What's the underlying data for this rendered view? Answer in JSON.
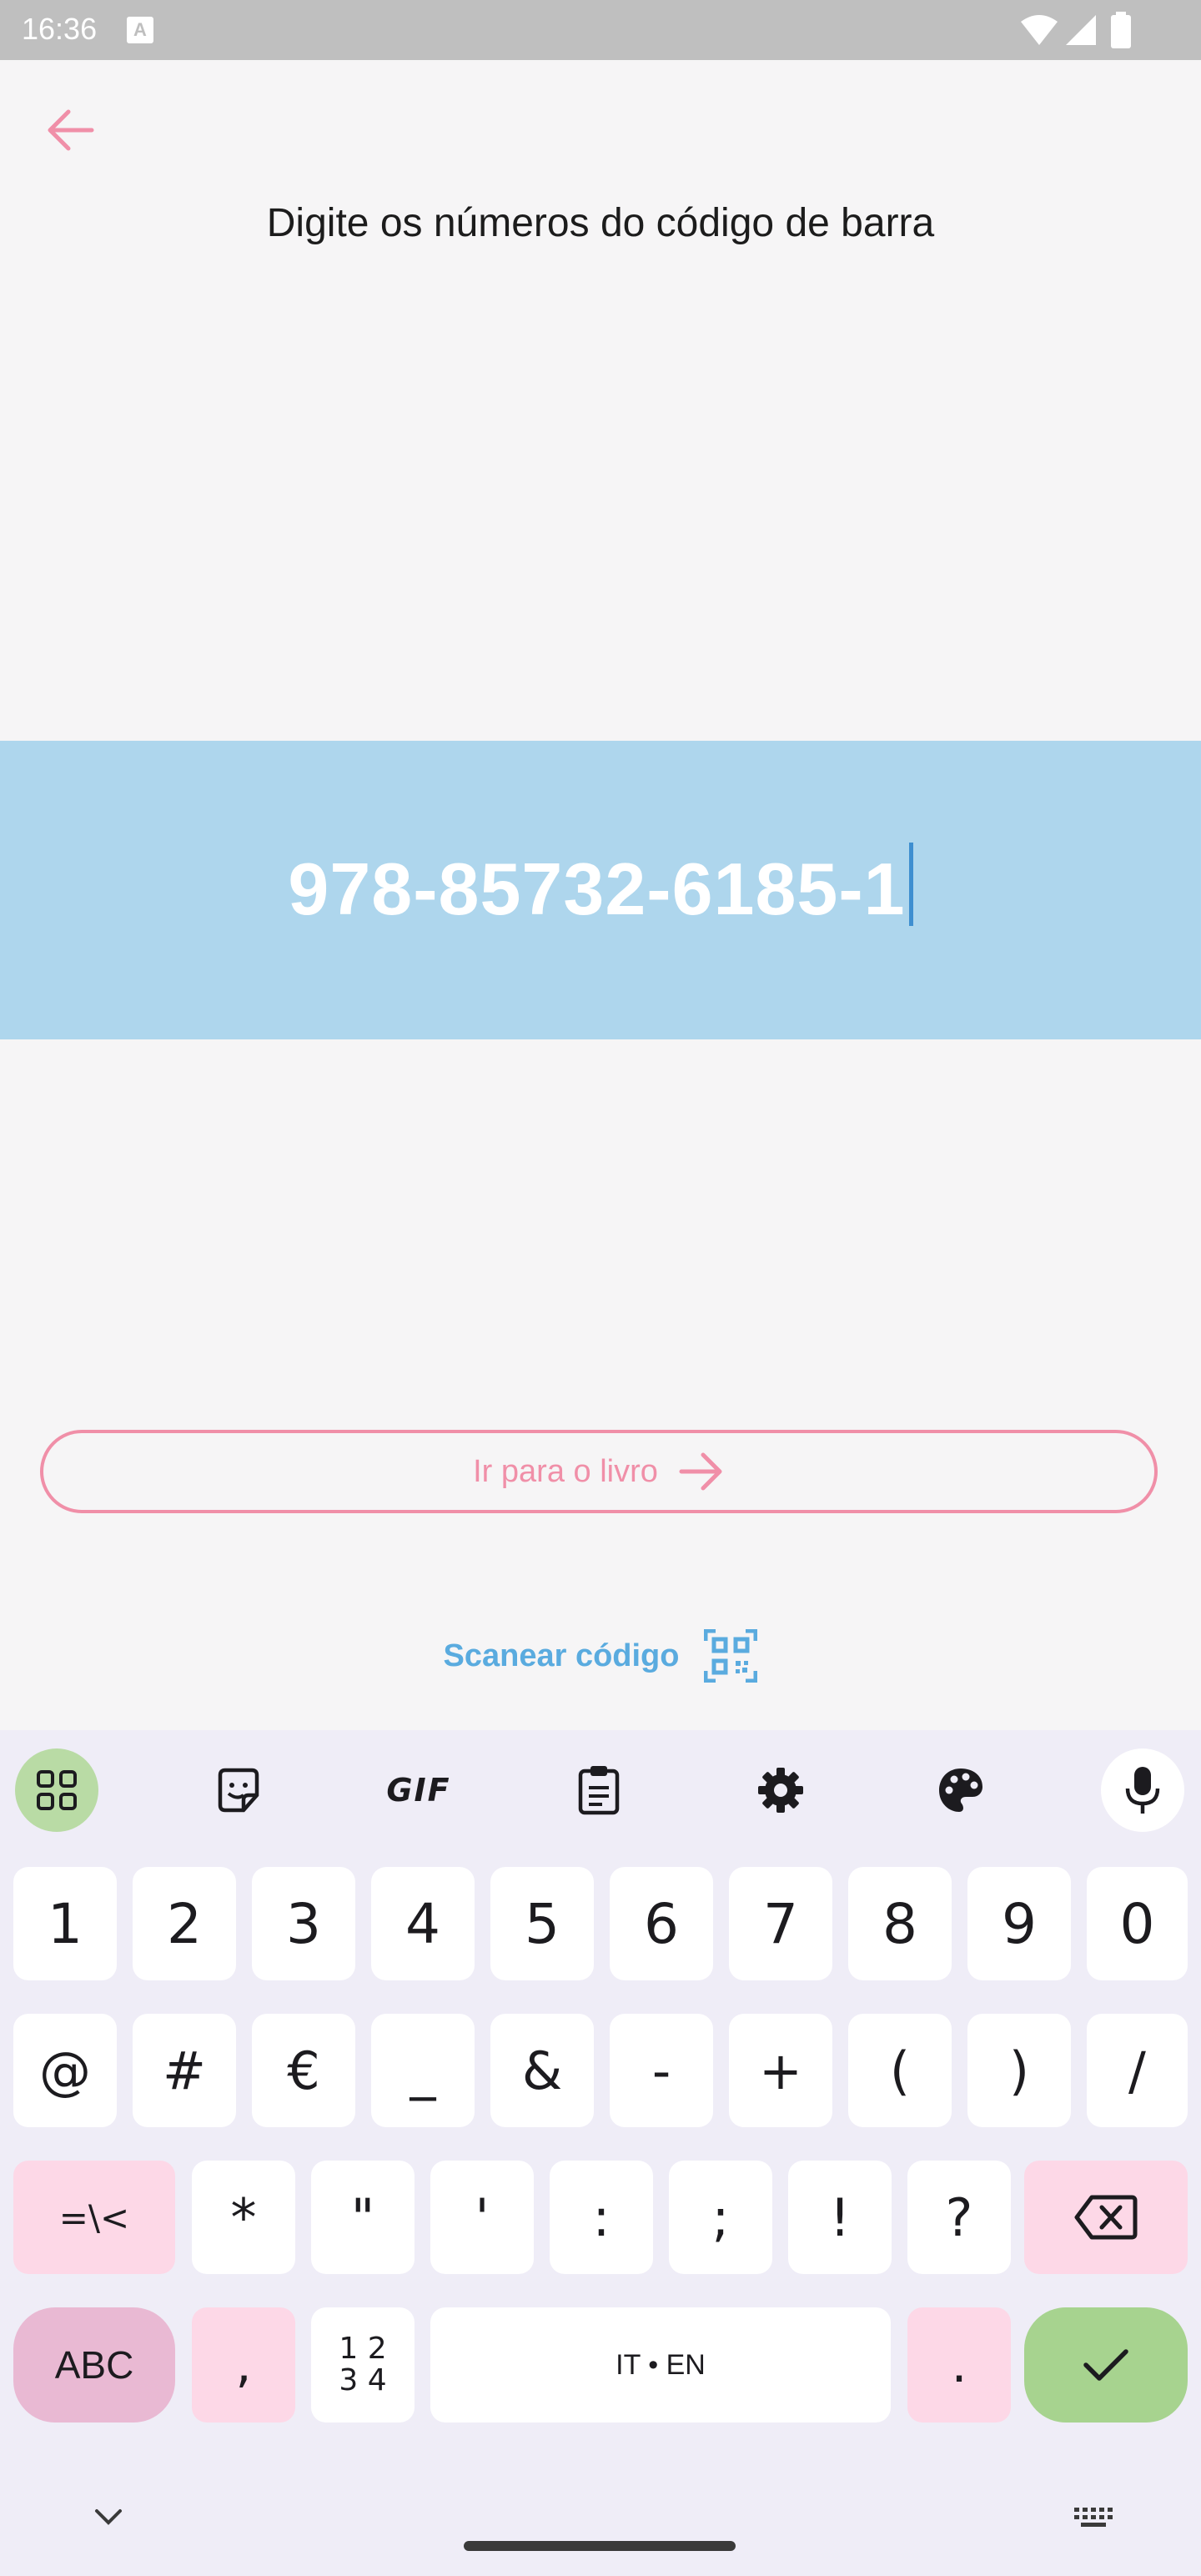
{
  "status_bar": {
    "time": "16:36",
    "notif_icon_letter": "A"
  },
  "header": {
    "title": "Digite os números do código de barra"
  },
  "barcode_input": {
    "value": "978-85732-6185-1"
  },
  "actions": {
    "go_book_label": "Ir para o livro",
    "scan_label": "Scanear código"
  },
  "colors": {
    "accent_pink": "#f08fa8",
    "input_band": "#aed6ed",
    "link_blue": "#5aabdf",
    "enter_green": "#a7d38f"
  },
  "keyboard": {
    "toolbar": [
      "apps-grid-icon",
      "sticker-icon",
      "gif-icon",
      "clipboard-icon",
      "settings-icon",
      "palette-icon",
      "mic-icon"
    ],
    "gif_label": "GIF",
    "row1": [
      "1",
      "2",
      "3",
      "4",
      "5",
      "6",
      "7",
      "8",
      "9",
      "0"
    ],
    "row2": [
      "@",
      "#",
      "€",
      "_",
      "&",
      "-",
      "+",
      "(",
      ")",
      "/"
    ],
    "row3": [
      "=\\<",
      "*",
      "\"",
      "'",
      ":",
      ";",
      "!",
      "?"
    ],
    "abc_label": "ABC",
    "comma": ",",
    "numpad_label_top": "1 2",
    "numpad_label_bottom": "3 4",
    "space_label": "IT • EN",
    "period": "."
  }
}
